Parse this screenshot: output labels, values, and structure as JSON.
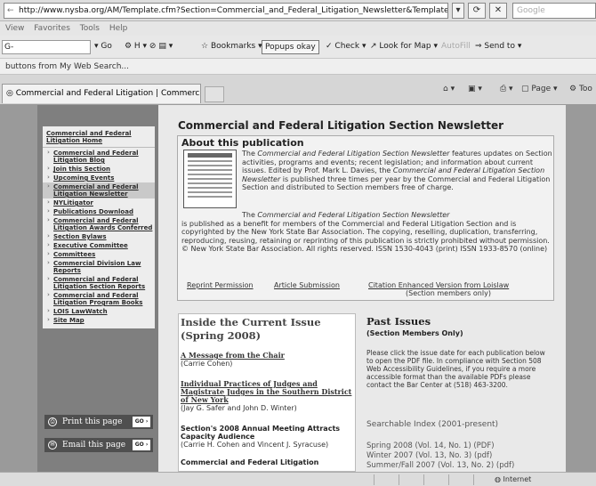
{
  "browser": {
    "url": "http://www.nysba.org/AM/Template.cfm?Section=Commercial_and_Federal_Litigation_Newsletter&Template=/TaggedPage/",
    "search_placeholder": "Google",
    "menu": [
      "View",
      "Favorites",
      "Tools",
      "Help"
    ],
    "google_box": "G-",
    "toolbar": {
      "go": "Go",
      "bookmarks": "Bookmarks",
      "popups": "Popups okay",
      "check": "Check",
      "lookfor": "Look for Map",
      "autofill": "AutoFill",
      "sendto": "Send to"
    },
    "links_bar": "buttons from My Web Search...",
    "tab_title": "Commercial and Federal Litigation | Commercial and F...",
    "page_menu": "Page",
    "tools_menu": "Too",
    "status_zone": "Internet"
  },
  "nav": {
    "home": "Commercial and Federal Litigation Home",
    "items": [
      "Commercial and Federal Litigation Blog",
      "Join this Section",
      "Upcoming Events",
      "Commercial and Federal Litigation Newsletter",
      "NYLitigator",
      "Publications Download",
      "Commercial and Federal Litigation Awards Conferred",
      "Section Bylaws",
      "Executive Committee",
      "Committees",
      "Commercial Division Law Reports",
      "Commercial and Federal Litigation Section Reports",
      "Commercial and Federal Litigation Program Books",
      "LOIS LawWatch",
      "Site Map"
    ],
    "print": "Print this page",
    "email": "Email this page",
    "go": "GO"
  },
  "main": {
    "title": "Commercial and Federal Litigation Section Newsletter",
    "about_heading": "About this publication",
    "about_p1_a": "The ",
    "about_p1_em": "Commercial and Federal Litigation Section Newsletter",
    "about_p1_b": " features updates on Section activities, programs and events; recent legislation; and information about current issues. Edited by Prof. Mark L. Davies, the ",
    "about_p1_em2": "Commercial and Federal Litigation Section Newsletter",
    "about_p1_c": " is published three times per year by the Commercial and Federal Litigation Section and distributed to Section members free of charge.",
    "about_p2_a": "The ",
    "about_p2_em": "Commercial and Federal Litigation Section Newsletter",
    "about_p2_b": " is published as a benefit for members of the Commercial and Federal Litigation Section and is copyrighted by the New York State Bar Association. The copying, reselling, duplication, transferring, reproducing, reusing, retaining or reprinting of this publication is strictly prohibited without permission. © New York State Bar Association. All rights reserved. ISSN 1530-4043 (print) ISSN 1933-8570 (online)",
    "link_reprint": "Reprint Permission",
    "link_article": "Article Submission",
    "link_citation": "Citation Enhanced Version from Loislaw",
    "citation_note": "(Section members only)"
  },
  "inside": {
    "heading": "Inside the Current Issue",
    "subheading": "(Spring 2008)",
    "articles": [
      {
        "title": "A Message from the Chair",
        "author": "(Carrie Cohen)"
      },
      {
        "title": "Individual Practices of Judges and Magistrate Judges in the Southern District of New York",
        "author": "(Jay G. Safer and John D. Winter)"
      },
      {
        "title": "Section's 2008 Annual Meeting Attracts Capacity Audience",
        "author": "(Carrie H. Cohen and Vincent J. Syracuse)"
      },
      {
        "title": "Commercial and Federal Litigation",
        "author": ""
      }
    ]
  },
  "past": {
    "heading": "Past Issues",
    "subheading": "(Section Members Only)",
    "body": "Please click the issue date for each publication below to open the PDF file. In compliance with Section 508 Web Accessibility Guidelines, if you require a more accessible format than the available PDFs please contact the Bar Center at (518) 463-3200.",
    "searchable": "Searchable Index (2001-present)",
    "issues": [
      "Spring 2008 (Vol. 14, No. 1) (PDF)",
      "Winter 2007 (Vol. 13, No. 3) (pdf)",
      "Summer/Fall 2007 (Vol. 13, No. 2) (pdf)"
    ]
  }
}
